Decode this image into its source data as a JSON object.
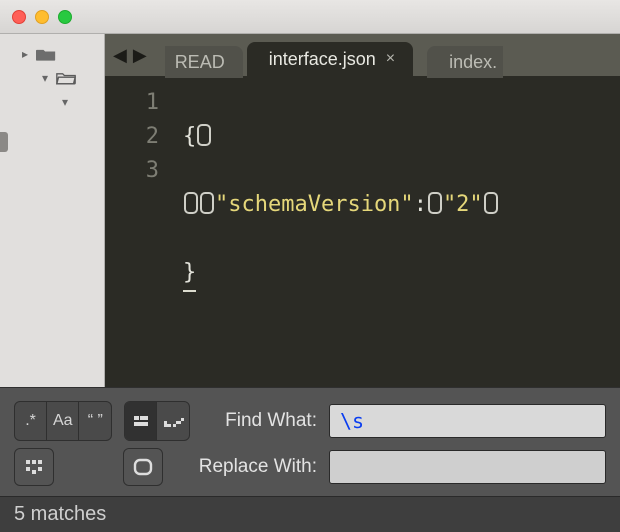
{
  "tabs": {
    "left": "READ",
    "active": "interface.json",
    "right": "index."
  },
  "gutter": {
    "l1": "1",
    "l2": "2",
    "l3": "3"
  },
  "code": {
    "open_brace": "{",
    "key": "\"schemaVersion\"",
    "colon": ":",
    "val": "\"2\"",
    "close_brace": "}"
  },
  "find": {
    "regex_label": ".*",
    "case_label": "Aa",
    "quotes_label": "“ ”",
    "find_label": "Find What:",
    "replace_label": "Replace With:",
    "find_value": "\\s",
    "replace_value": ""
  },
  "status": {
    "matches": "5 matches"
  }
}
